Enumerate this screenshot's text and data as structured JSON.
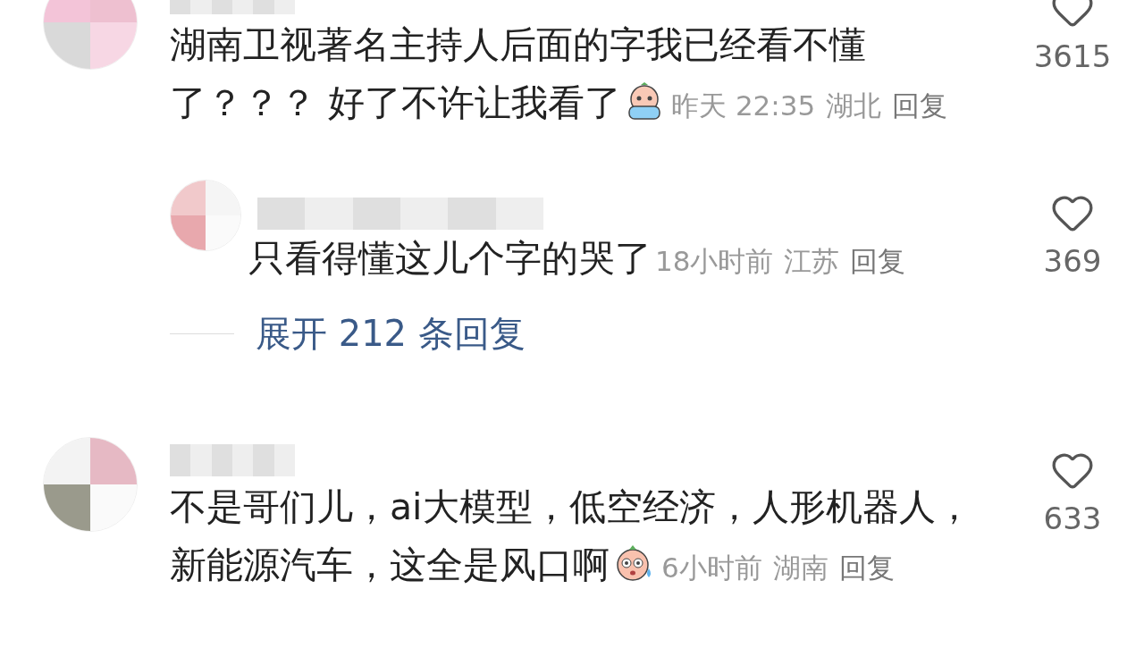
{
  "comments": [
    {
      "text": "湖南卫视著名主持人后面的字我已经看不懂了？？？ 好了不许让我看了",
      "emoji": {
        "kind": "crying"
      },
      "time": "昨天 22:35",
      "location": "湖北",
      "reply": "回复",
      "likes": "3615",
      "replies": [
        {
          "text": "只看得懂这儿个字的哭了",
          "time": "18小时前",
          "location": "江苏",
          "reply": "回复",
          "likes": "369"
        }
      ],
      "expand": "展开 212 条回复"
    },
    {
      "text": "不是哥们儿，ai大模型，低空经济，人形机器人，新能源汽车，这全是风口啊",
      "emoji": {
        "kind": "sweat"
      },
      "time": "6小时前",
      "location": "湖南",
      "reply": "回复",
      "likes": "633"
    }
  ]
}
